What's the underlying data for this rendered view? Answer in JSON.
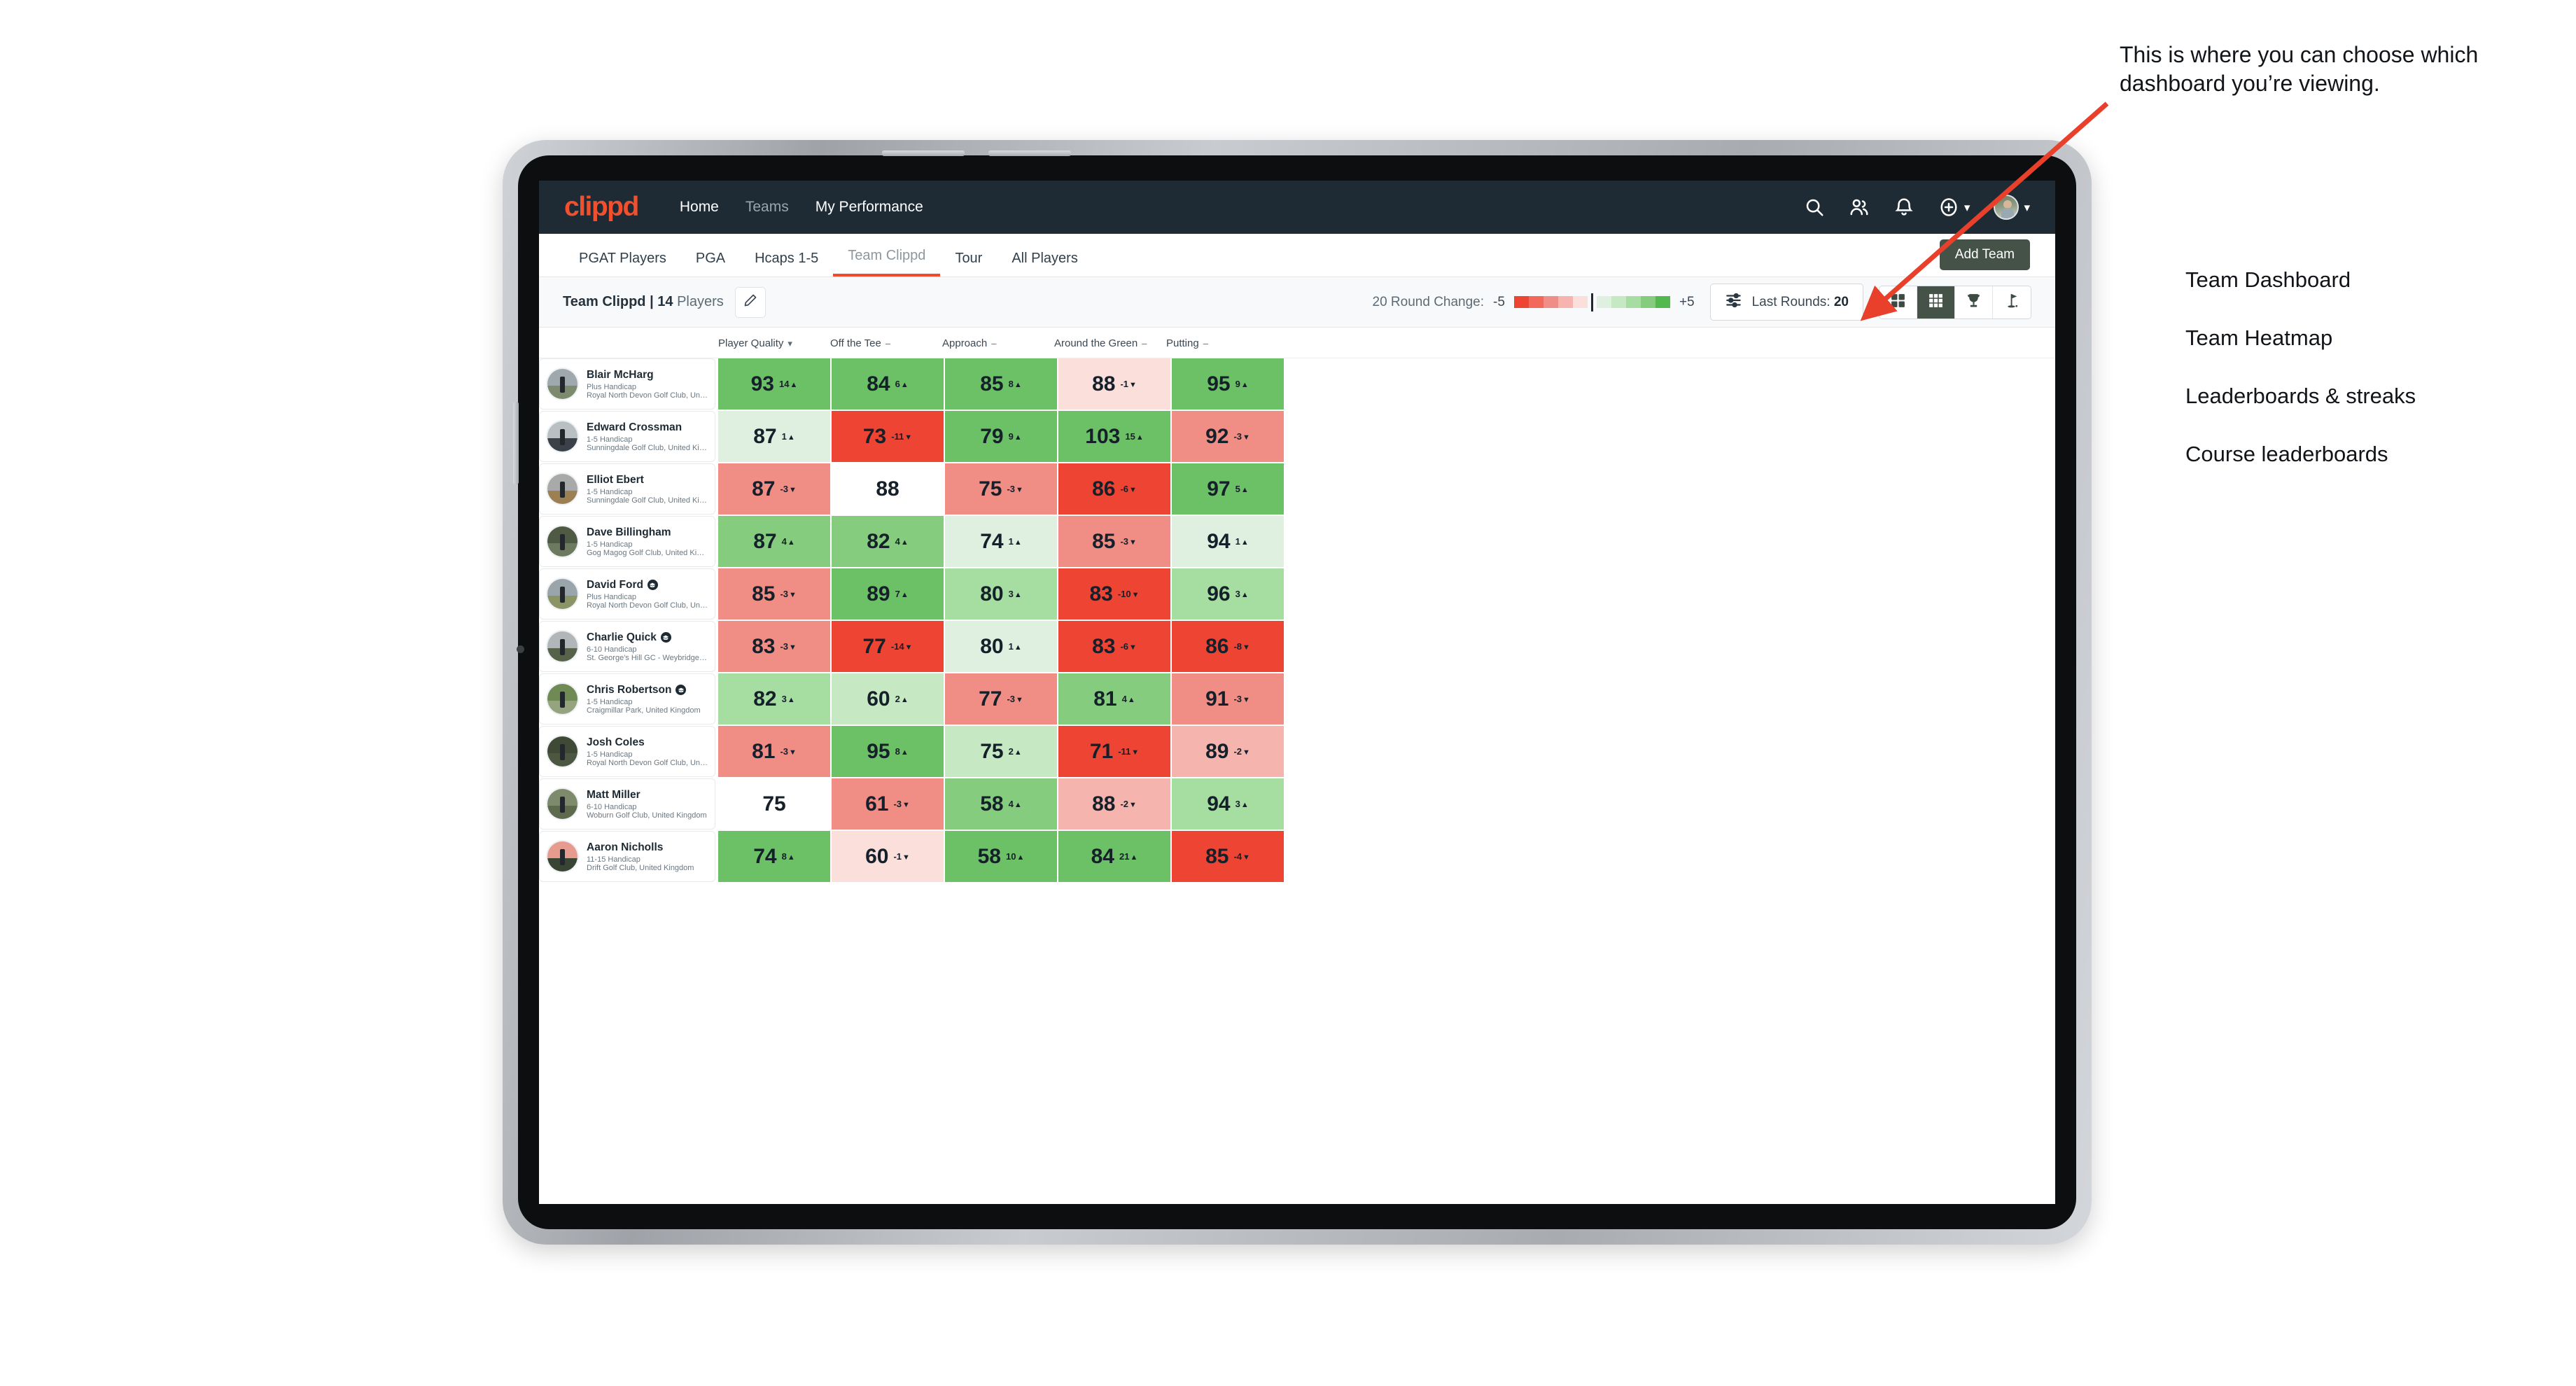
{
  "nav": {
    "logo": "clippd",
    "links": [
      {
        "label": "Home",
        "dim": false
      },
      {
        "label": "Teams",
        "dim": true
      },
      {
        "label": "My Performance",
        "dim": false
      }
    ],
    "icons": [
      "search-icon",
      "people-icon",
      "bell-icon",
      "plus-circle-icon",
      "avatar"
    ]
  },
  "tabs": [
    {
      "label": "PGAT Players",
      "active": false
    },
    {
      "label": "PGA",
      "active": false
    },
    {
      "label": "Hcaps 1-5",
      "active": false
    },
    {
      "label": "Team Clippd",
      "active": true
    },
    {
      "label": "Tour",
      "active": false
    },
    {
      "label": "All Players",
      "active": false
    }
  ],
  "add_team_label": "Add Team",
  "toolbar": {
    "team_name": "Team Clippd",
    "separator": "|",
    "player_count": "14",
    "players_word": "Players",
    "edit_icon": "pencil-icon",
    "round_change_label": "20 Round Change:",
    "scale_min": "-5",
    "scale_max": "+5",
    "last_rounds_label": "Last Rounds:",
    "last_rounds_value": "20",
    "filter_icon": "sliders-icon",
    "views": [
      {
        "name": "team-dashboard",
        "icon": "grid-4-icon",
        "active": false
      },
      {
        "name": "team-heatmap",
        "icon": "grid-9-icon",
        "active": true
      },
      {
        "name": "leaderboards-streaks",
        "icon": "trophy-icon",
        "active": false
      },
      {
        "name": "course-leaderboards",
        "icon": "flag-icon",
        "active": false
      }
    ]
  },
  "columns": [
    {
      "label": "Player Quality",
      "marker": "chevron-down"
    },
    {
      "label": "Off the Tee",
      "marker": "dash"
    },
    {
      "label": "Approach",
      "marker": "dash"
    },
    {
      "label": "Around the Green",
      "marker": "dash"
    },
    {
      "label": "Putting",
      "marker": "dash"
    }
  ],
  "chart_data": {
    "type": "heatmap",
    "title": "Team Clippd | 14 Players",
    "categories": [
      "Player Quality",
      "Off the Tee",
      "Approach",
      "Around the Green",
      "Putting"
    ],
    "legend": {
      "label": "20 Round Change",
      "min": -5,
      "max": 5
    },
    "rows": [
      {
        "name": "Blair McHarg",
        "handicap": "Plus Handicap",
        "club": "Royal North Devon Golf Club, United Kingdom",
        "badge": false,
        "avatar_sky": "#9fa8ad",
        "avatar_ground": "#7d8a6d",
        "cells": [
          {
            "value": "93",
            "delta": "14",
            "dir": "up",
            "bg": "#6cc066"
          },
          {
            "value": "84",
            "delta": "6",
            "dir": "up",
            "bg": "#6cc066"
          },
          {
            "value": "85",
            "delta": "8",
            "dir": "up",
            "bg": "#6cc066"
          },
          {
            "value": "88",
            "delta": "-1",
            "dir": "down",
            "bg": "#fadfdb"
          },
          {
            "value": "95",
            "delta": "9",
            "dir": "up",
            "bg": "#6cc066"
          }
        ]
      },
      {
        "name": "Edward Crossman",
        "handicap": "1-5 Handicap",
        "club": "Sunningdale Golf Club, United Kingdom",
        "badge": false,
        "avatar_sky": "#b9c0c4",
        "avatar_ground": "#3b4148",
        "cells": [
          {
            "value": "87",
            "delta": "1",
            "dir": "up",
            "bg": "#dff0e1"
          },
          {
            "value": "73",
            "delta": "-11",
            "dir": "down",
            "bg": "#ee4433"
          },
          {
            "value": "79",
            "delta": "9",
            "dir": "up",
            "bg": "#6cc066"
          },
          {
            "value": "103",
            "delta": "15",
            "dir": "up",
            "bg": "#6cc066"
          },
          {
            "value": "92",
            "delta": "-3",
            "dir": "down",
            "bg": "#f08d84"
          }
        ]
      },
      {
        "name": "Elliot Ebert",
        "handicap": "1-5 Handicap",
        "club": "Sunningdale Golf Club, United Kingdom",
        "badge": false,
        "avatar_sky": "#a7aaa8",
        "avatar_ground": "#9c7f52",
        "cells": [
          {
            "value": "87",
            "delta": "-3",
            "dir": "down",
            "bg": "#f08d84"
          },
          {
            "value": "88",
            "delta": "",
            "dir": "",
            "bg": "#ffffff"
          },
          {
            "value": "75",
            "delta": "-3",
            "dir": "down",
            "bg": "#f08d84"
          },
          {
            "value": "86",
            "delta": "-6",
            "dir": "down",
            "bg": "#ee4433"
          },
          {
            "value": "97",
            "delta": "5",
            "dir": "up",
            "bg": "#6cc066"
          }
        ]
      },
      {
        "name": "Dave Billingham",
        "handicap": "1-5 Handicap",
        "club": "Gog Magog Golf Club, United Kingdom",
        "badge": false,
        "avatar_sky": "#4f5a44",
        "avatar_ground": "#6d7a60",
        "cells": [
          {
            "value": "87",
            "delta": "4",
            "dir": "up",
            "bg": "#85cc7e"
          },
          {
            "value": "82",
            "delta": "4",
            "dir": "up",
            "bg": "#85cc7e"
          },
          {
            "value": "74",
            "delta": "1",
            "dir": "up",
            "bg": "#dff0e1"
          },
          {
            "value": "85",
            "delta": "-3",
            "dir": "down",
            "bg": "#f08d84"
          },
          {
            "value": "94",
            "delta": "1",
            "dir": "up",
            "bg": "#dff0e1"
          }
        ]
      },
      {
        "name": "David Ford",
        "handicap": "Plus Handicap",
        "club": "Royal North Devon Golf Club, United Kingdom",
        "badge": true,
        "avatar_sky": "#9aa4ab",
        "avatar_ground": "#8a9464",
        "cells": [
          {
            "value": "85",
            "delta": "-3",
            "dir": "down",
            "bg": "#f08d84"
          },
          {
            "value": "89",
            "delta": "7",
            "dir": "up",
            "bg": "#6cc066"
          },
          {
            "value": "80",
            "delta": "3",
            "dir": "up",
            "bg": "#a6dda1"
          },
          {
            "value": "83",
            "delta": "-10",
            "dir": "down",
            "bg": "#ee4433"
          },
          {
            "value": "96",
            "delta": "3",
            "dir": "up",
            "bg": "#a6dda1"
          }
        ]
      },
      {
        "name": "Charlie Quick",
        "handicap": "6-10 Handicap",
        "club": "St. George's Hill GC - Weybridge - Surrey, Uni...",
        "badge": true,
        "avatar_sky": "#b2b6b8",
        "avatar_ground": "#57624b",
        "cells": [
          {
            "value": "83",
            "delta": "-3",
            "dir": "down",
            "bg": "#f08d84"
          },
          {
            "value": "77",
            "delta": "-14",
            "dir": "down",
            "bg": "#ee4433"
          },
          {
            "value": "80",
            "delta": "1",
            "dir": "up",
            "bg": "#dff0e1"
          },
          {
            "value": "83",
            "delta": "-6",
            "dir": "down",
            "bg": "#ee4433"
          },
          {
            "value": "86",
            "delta": "-8",
            "dir": "down",
            "bg": "#ee4433"
          }
        ]
      },
      {
        "name": "Chris Robertson",
        "handicap": "1-5 Handicap",
        "club": "Craigmillar Park, United Kingdom",
        "badge": true,
        "avatar_sky": "#6f8a55",
        "avatar_ground": "#95a37f",
        "cells": [
          {
            "value": "82",
            "delta": "3",
            "dir": "up",
            "bg": "#a6dda1"
          },
          {
            "value": "60",
            "delta": "2",
            "dir": "up",
            "bg": "#c6e8c2"
          },
          {
            "value": "77",
            "delta": "-3",
            "dir": "down",
            "bg": "#f08d84"
          },
          {
            "value": "81",
            "delta": "4",
            "dir": "up",
            "bg": "#85cc7e"
          },
          {
            "value": "91",
            "delta": "-3",
            "dir": "down",
            "bg": "#f08d84"
          }
        ]
      },
      {
        "name": "Josh Coles",
        "handicap": "1-5 Handicap",
        "club": "Royal North Devon Golf Club, United Kingdom",
        "badge": false,
        "avatar_sky": "#3f4a36",
        "avatar_ground": "#4b5740",
        "cells": [
          {
            "value": "81",
            "delta": "-3",
            "dir": "down",
            "bg": "#f08d84"
          },
          {
            "value": "95",
            "delta": "8",
            "dir": "up",
            "bg": "#6cc066"
          },
          {
            "value": "75",
            "delta": "2",
            "dir": "up",
            "bg": "#c6e8c2"
          },
          {
            "value": "71",
            "delta": "-11",
            "dir": "down",
            "bg": "#ee4433"
          },
          {
            "value": "89",
            "delta": "-2",
            "dir": "down",
            "bg": "#f5b5ae"
          }
        ]
      },
      {
        "name": "Matt Miller",
        "handicap": "6-10 Handicap",
        "club": "Woburn Golf Club, United Kingdom",
        "badge": false,
        "avatar_sky": "#7e8a6c",
        "avatar_ground": "#5d6a4e",
        "cells": [
          {
            "value": "75",
            "delta": "",
            "dir": "",
            "bg": "#ffffff"
          },
          {
            "value": "61",
            "delta": "-3",
            "dir": "down",
            "bg": "#f08d84"
          },
          {
            "value": "58",
            "delta": "4",
            "dir": "up",
            "bg": "#85cc7e"
          },
          {
            "value": "88",
            "delta": "-2",
            "dir": "down",
            "bg": "#f5b5ae"
          },
          {
            "value": "94",
            "delta": "3",
            "dir": "up",
            "bg": "#a6dda1"
          }
        ]
      },
      {
        "name": "Aaron Nicholls",
        "handicap": "11-15 Handicap",
        "club": "Drift Golf Club, United Kingdom",
        "badge": false,
        "avatar_sky": "#e79a8e",
        "avatar_ground": "#3a4434",
        "cells": [
          {
            "value": "74",
            "delta": "8",
            "dir": "up",
            "bg": "#6cc066"
          },
          {
            "value": "60",
            "delta": "-1",
            "dir": "down",
            "bg": "#fadfdb"
          },
          {
            "value": "58",
            "delta": "10",
            "dir": "up",
            "bg": "#6cc066"
          },
          {
            "value": "84",
            "delta": "21",
            "dir": "up",
            "bg": "#6cc066"
          },
          {
            "value": "85",
            "delta": "-4",
            "dir": "down",
            "bg": "#ee4433"
          }
        ]
      }
    ]
  },
  "annotation": {
    "callout": "This is where you can choose which dashboard you’re viewing.",
    "arrow_color": "#e8402a",
    "dashboard_options": [
      "Team Dashboard",
      "Team Heatmap",
      "Leaderboards & streaks",
      "Course leaderboards"
    ]
  }
}
